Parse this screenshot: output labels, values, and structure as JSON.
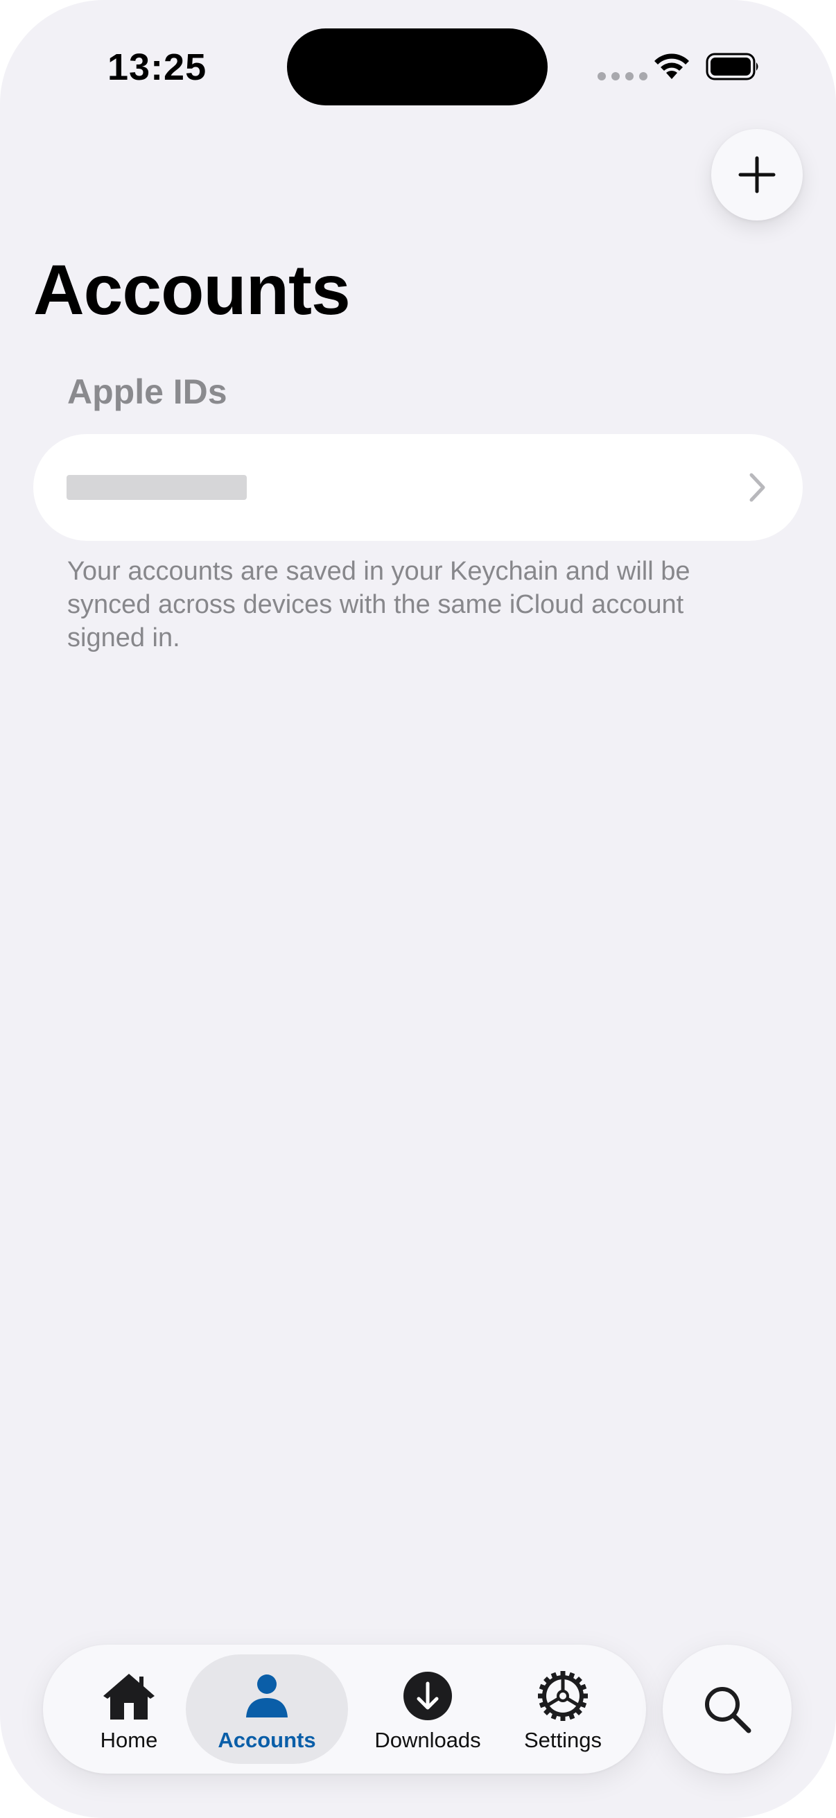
{
  "status_bar": {
    "time": "13:25",
    "icons": [
      "cellular-dots-icon",
      "wifi-icon",
      "battery-icon"
    ]
  },
  "nav": {
    "add_icon": "plus-icon"
  },
  "page": {
    "title": "Accounts",
    "section_header": "Apple IDs",
    "account_row": {
      "value": "",
      "chevron_icon": "chevron-right-icon"
    },
    "footer": "Your accounts are saved in your Keychain and will be synced across devices with the same iCloud account signed in."
  },
  "tab_bar": {
    "active": "Accounts",
    "accent_color": "#0a5ea8",
    "tabs": [
      {
        "label": "Home",
        "icon": "house-icon"
      },
      {
        "label": "Accounts",
        "icon": "person-icon"
      },
      {
        "label": "Downloads",
        "icon": "arrow-down-circle-icon"
      },
      {
        "label": "Settings",
        "icon": "gear-icon"
      }
    ],
    "search_icon": "magnifying-glass-icon"
  }
}
